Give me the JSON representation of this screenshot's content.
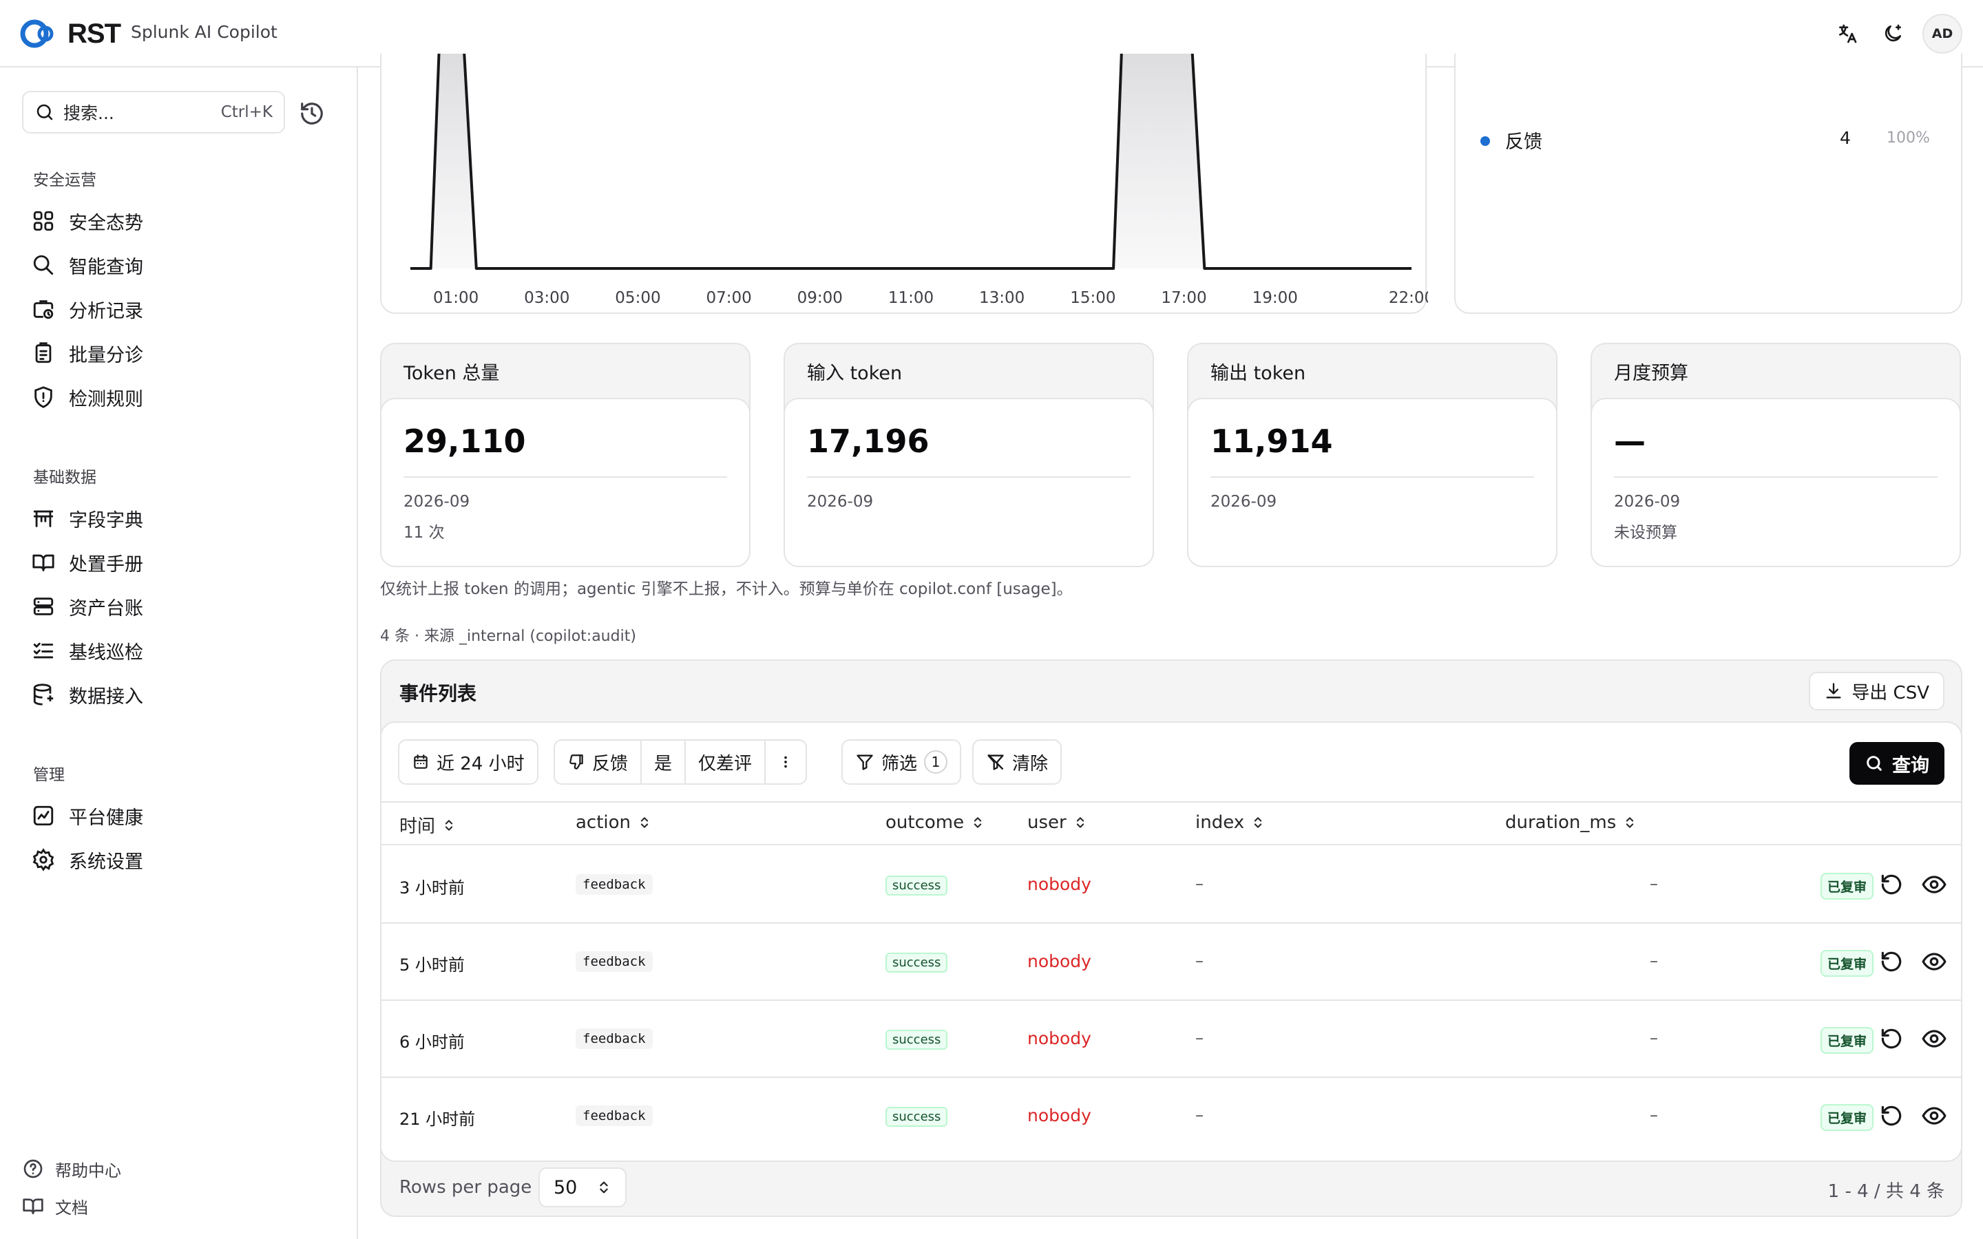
{
  "header": {
    "logo_text": "RST",
    "app_name": "Splunk AI Copilot",
    "avatar_initials": "AD"
  },
  "sidebar": {
    "search_placeholder": "搜索...",
    "search_shortcut": "Ctrl+K",
    "groups": [
      {
        "label": "安全运营",
        "items": [
          "安全态势",
          "智能查询",
          "分析记录",
          "批量分诊",
          "检测规则"
        ]
      },
      {
        "label": "基础数据",
        "items": [
          "字段字典",
          "处置手册",
          "资产台账",
          "基线巡检",
          "数据接入"
        ]
      },
      {
        "label": "管理",
        "items": [
          "平台健康",
          "系统设置"
        ]
      }
    ],
    "footer": [
      "帮助中心",
      "文档"
    ]
  },
  "chart": {
    "x_ticks": [
      "01:00",
      "03:00",
      "05:00",
      "07:00",
      "09:00",
      "11:00",
      "13:00",
      "15:00",
      "17:00",
      "19:00",
      "22:00"
    ]
  },
  "chart_data": {
    "type": "area",
    "x": [
      "00:00",
      "01:00",
      "02:00",
      "03:00",
      "04:00",
      "05:00",
      "06:00",
      "07:00",
      "08:00",
      "09:00",
      "10:00",
      "11:00",
      "12:00",
      "13:00",
      "14:00",
      "15:00",
      "16:00",
      "17:00",
      "18:00",
      "19:00",
      "20:00",
      "21:00",
      "22:00"
    ],
    "values": [
      0,
      1,
      0,
      0,
      0,
      0,
      0,
      0,
      0,
      0,
      0,
      0,
      0,
      0,
      0,
      0,
      1,
      1,
      0,
      0,
      0,
      0,
      0
    ],
    "x_tick_labels": [
      "01:00",
      "03:00",
      "05:00",
      "07:00",
      "09:00",
      "11:00",
      "13:00",
      "15:00",
      "17:00",
      "19:00",
      "22:00"
    ],
    "grid": false
  },
  "legend": {
    "label": "反馈",
    "value": "4",
    "percent": "100%",
    "color": "#1d6fd1"
  },
  "stats": [
    {
      "title": "Token 总量",
      "value": "29,110",
      "sub1": "2026-09",
      "sub2": "11 次"
    },
    {
      "title": "输入 token",
      "value": "17,196",
      "sub1": "2026-09",
      "sub2": ""
    },
    {
      "title": "输出 token",
      "value": "11,914",
      "sub1": "2026-09",
      "sub2": ""
    },
    {
      "title": "月度预算",
      "value": "—",
      "sub1": "2026-09",
      "sub2": "未设预算"
    }
  ],
  "note": "仅统计上报 token 的调用；agentic 引擎不上报，不计入。预算与单价在 copilot.conf [usage]。",
  "source": "4 条 · 来源 _internal (copilot:audit)",
  "events": {
    "title": "事件列表",
    "export_label": "导出 CSV",
    "time_range": "近 24 小时",
    "filter_field": "反馈",
    "filter_op": "是",
    "filter_value": "仅差评",
    "filter_label": "筛选",
    "filter_count": "1",
    "clear_label": "清除",
    "query_label": "查询",
    "columns": [
      "时间",
      "action",
      "outcome",
      "user",
      "index",
      "duration_ms"
    ],
    "rows": [
      {
        "time": "3 小时前",
        "action": "feedback",
        "outcome": "success",
        "user": "nobody",
        "index": "–",
        "duration": "–",
        "status": "已复审"
      },
      {
        "time": "5 小时前",
        "action": "feedback",
        "outcome": "success",
        "user": "nobody",
        "index": "–",
        "duration": "–",
        "status": "已复审"
      },
      {
        "time": "6 小时前",
        "action": "feedback",
        "outcome": "success",
        "user": "nobody",
        "index": "–",
        "duration": "–",
        "status": "已复审"
      },
      {
        "time": "21 小时前",
        "action": "feedback",
        "outcome": "success",
        "user": "nobody",
        "index": "–",
        "duration": "–",
        "status": "已复审"
      }
    ],
    "rows_per_page_label": "Rows per page",
    "rows_per_page": "50",
    "pager": "1 - 4 / 共 4 条"
  }
}
